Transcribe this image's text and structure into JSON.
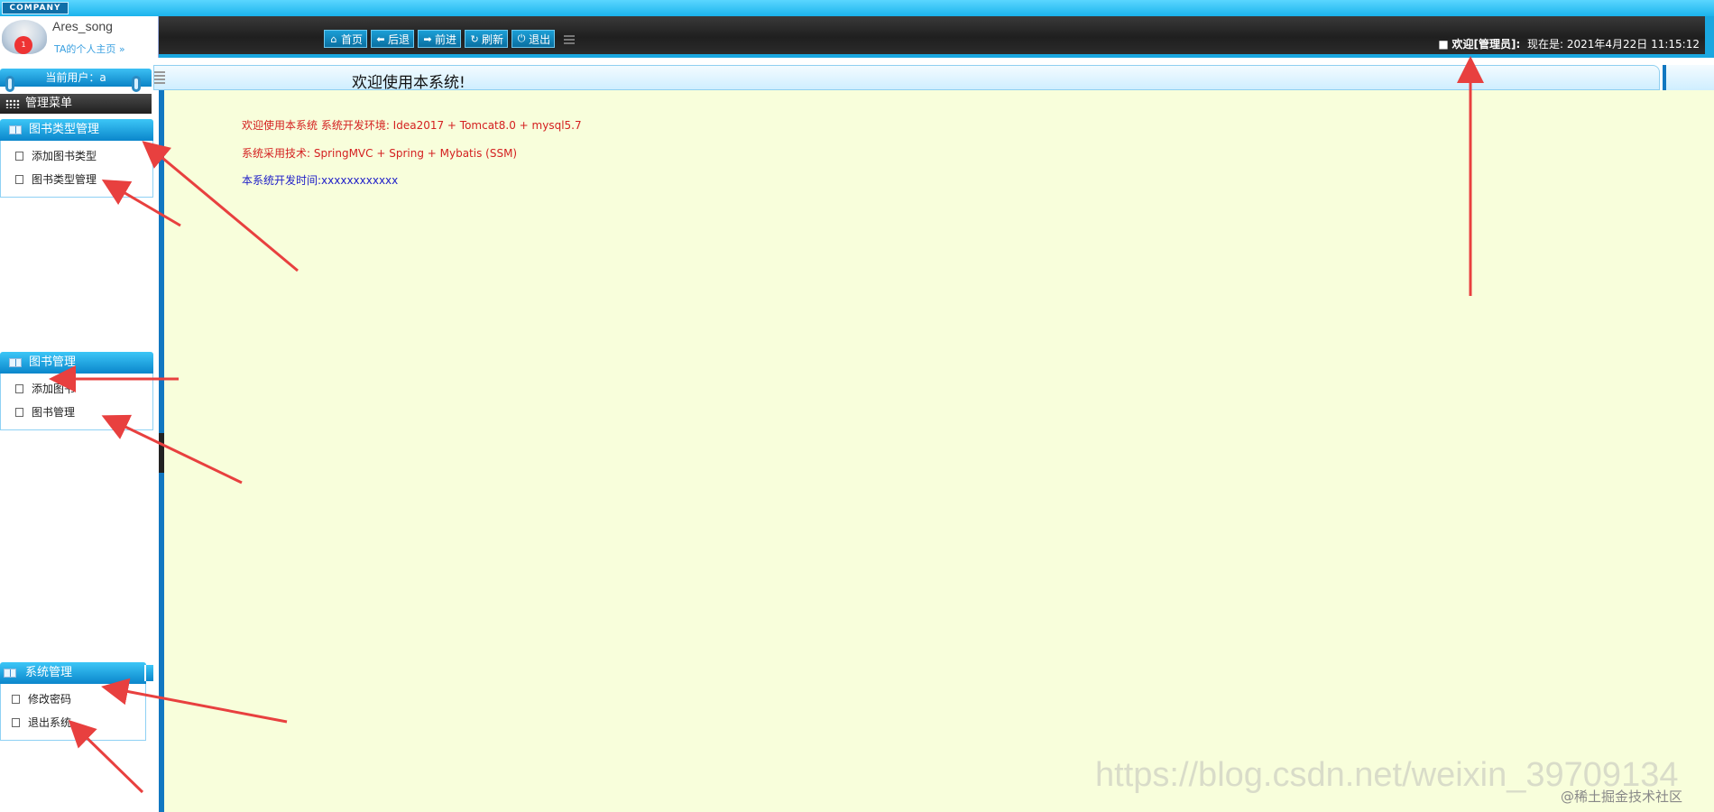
{
  "header": {
    "company_logo_text": "COMPANY",
    "profile_name": "Ares_song",
    "profile_link": "TA的个人主页 »",
    "avatar_badge": "1",
    "toolbar": [
      {
        "label": "首页",
        "icon": "home-icon",
        "glyph": "⌂"
      },
      {
        "label": "后退",
        "icon": "back-arrow-icon",
        "glyph": "⬅"
      },
      {
        "label": "前进",
        "icon": "forward-arrow-icon",
        "glyph": "➡"
      },
      {
        "label": "刷新",
        "icon": "refresh-icon",
        "glyph": "↻"
      },
      {
        "label": "退出",
        "icon": "power-icon",
        "glyph": "⏻"
      }
    ],
    "welcome_bullet": "■",
    "welcome_text": "欢迎[管理员]:",
    "time_label": "现在是:",
    "time_value": "2021年4月22日 11:15:12"
  },
  "sidebar": {
    "current_user_label": "当前用户：a",
    "manage_menu_label": "管理菜单",
    "groups": [
      {
        "title": "图书类型管理",
        "items": [
          "添加图书类型",
          "图书类型管理"
        ]
      },
      {
        "title": "图书管理",
        "items": [
          "添加图书",
          "图书管理"
        ]
      },
      {
        "title": "系统管理",
        "items": [
          "修改密码",
          "退出系统"
        ]
      }
    ]
  },
  "main": {
    "title": "欢迎使用本系统!",
    "lines": [
      "欢迎使用本系统 系统开发环境: Idea2017 + Tomcat8.0 + mysql5.7",
      "系统采用技术: SpringMVC + Spring + Mybatis (SSM)",
      "本系统开发时间:xxxxxxxxxxxx"
    ]
  },
  "watermark": {
    "url_text": "https://blog.csdn.net/weixin_39709134",
    "community_text": "@稀土掘金技术社区"
  },
  "colors": {
    "accent_blue": "#1aa7e0",
    "content_bg": "#f8fedb",
    "info_red": "#d42020",
    "info_blue": "#2020c8",
    "arrow_red": "#e8403f"
  }
}
